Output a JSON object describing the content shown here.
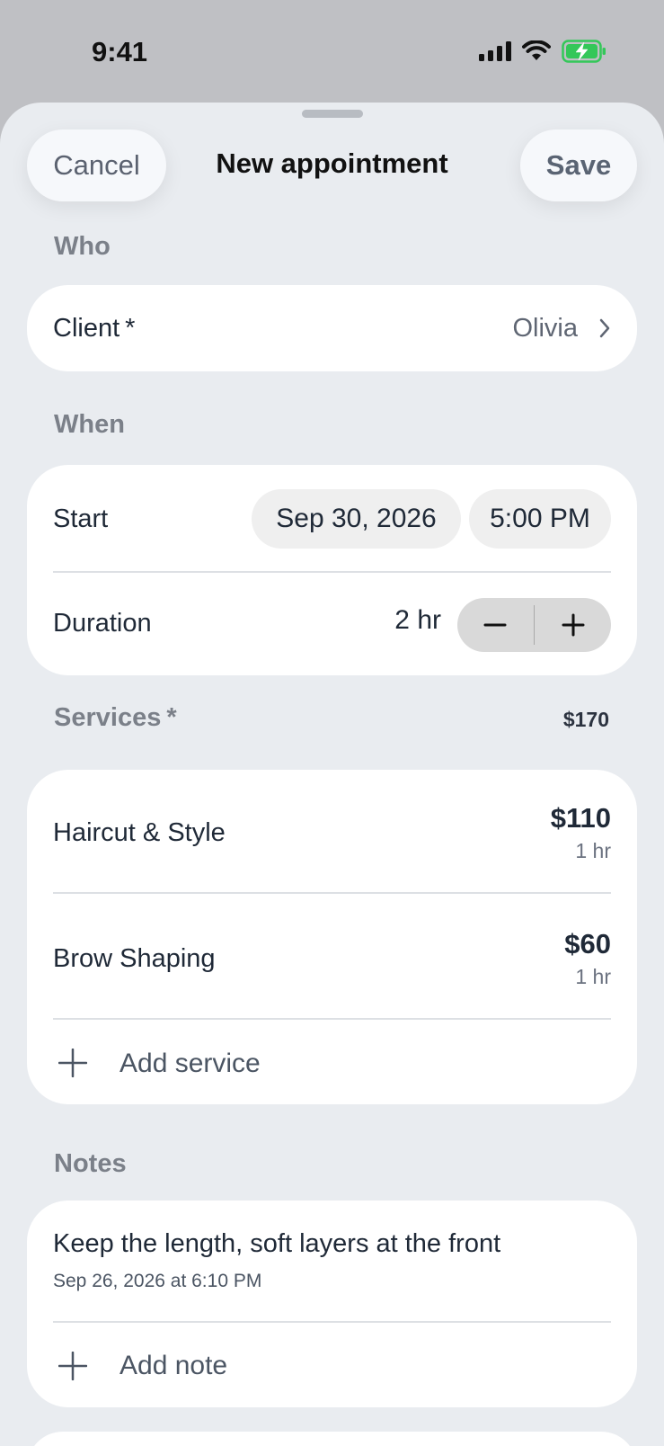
{
  "status_bar": {
    "time": "9:41",
    "icons": [
      "cellular-signal-icon",
      "wifi-icon",
      "battery-charging-icon"
    ],
    "battery_color": "#34c759"
  },
  "header": {
    "cancel_label": "Cancel",
    "title": "New appointment",
    "save_label": "Save"
  },
  "who": {
    "section_label": "Who",
    "client_label": "Client",
    "required_mark": "*",
    "client_value": "Olivia"
  },
  "when": {
    "section_label": "When",
    "start_label": "Start",
    "start_date": "Sep 30, 2026",
    "start_time": "5:00 PM",
    "duration_label": "Duration",
    "duration_value": "2 hr",
    "decrement": "−",
    "increment": "+"
  },
  "services": {
    "section_label": "Services",
    "required_mark": "*",
    "total": "$170",
    "items": [
      {
        "name": "Haircut & Style",
        "price": "$110",
        "duration": "1 hr"
      },
      {
        "name": "Brow Shaping",
        "price": "$60",
        "duration": "1 hr"
      }
    ],
    "add_label": "Add service"
  },
  "notes": {
    "section_label": "Notes",
    "items": [
      {
        "text": "Keep the length, soft layers at the front",
        "timestamp": "Sep 26, 2026 at 6:10 PM"
      }
    ],
    "add_label": "Add note"
  }
}
